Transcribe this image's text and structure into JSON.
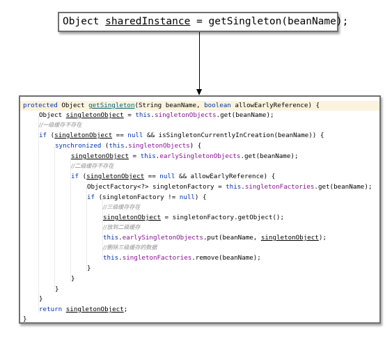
{
  "top_call": {
    "type_name": "Object",
    "var_name": "sharedInstance",
    "rhs": "= getSingleton(beanName);"
  },
  "code": {
    "signature": {
      "kw_protected": "protected",
      "ret_type": "Object",
      "method": "getSingleton",
      "params_a": "(String beanName, ",
      "kw_boolean": "boolean",
      "params_b": "allowEarlyReference) {"
    },
    "l2": {
      "a": "Object ",
      "b": "singletonObject",
      "c": " = ",
      "kw": "this",
      "d": ".",
      "fld": "singletonObjects",
      "e": ".get(beanName);"
    },
    "l3_comment": "//一级缓存不存在",
    "l4": {
      "kw": "if",
      "a": " (",
      "b": "singletonObject",
      "c": " == ",
      "kw2": "null",
      "d": " && isSingletonCurrentlyInCreation(beanName)) {"
    },
    "l5": {
      "kw": "synchronized",
      "a": " (",
      "kw2": "this",
      "b": ".",
      "fld": "singletonObjects",
      "c": ") {"
    },
    "l6": {
      "b": "singletonObject",
      "c": " = ",
      "kw": "this",
      "d": ".",
      "fld": "earlySingletonObjects",
      "e": ".get(beanName);"
    },
    "l7_comment": "//二级缓存不存在",
    "l8": {
      "kw": "if",
      "a": " (",
      "b": "singletonObject",
      "c": " == ",
      "kw2": "null",
      "d": " && allowEarlyReference) {"
    },
    "l9": {
      "a": "ObjectFactory<?> singletonFactory = ",
      "kw": "this",
      "b": ".",
      "fld": "singletonFactories",
      "c": ".get(beanName);"
    },
    "l10": {
      "kw": "if",
      "a": " (singletonFactory != ",
      "kw2": "null",
      "b": ") {"
    },
    "l11_comment": "//三级缓存存在",
    "l12": {
      "b": "singletonObject",
      "c": " = singletonFactory.getObject();"
    },
    "l13_comment": "//放到二级缓存",
    "l14": {
      "kw": "this",
      "a": ".",
      "fld": "earlySingletonObjects",
      "b": ".put(beanName, ",
      "u": "singletonObject",
      "c": ");"
    },
    "l15_comment": "//删除三级缓存的数据",
    "l16": {
      "kw": "this",
      "a": ".",
      "fld": "singletonFactories",
      "b": ".remove(beanName);"
    },
    "brace": "}",
    "l22": {
      "kw": "return",
      "a": " ",
      "u": "singletonObject",
      "b": ";"
    }
  },
  "colors": {
    "keyword": "#0033b3",
    "field": "#871094",
    "method": "#00627a",
    "comment": "#8c8c8c",
    "highlight": "#fbf3dd"
  }
}
